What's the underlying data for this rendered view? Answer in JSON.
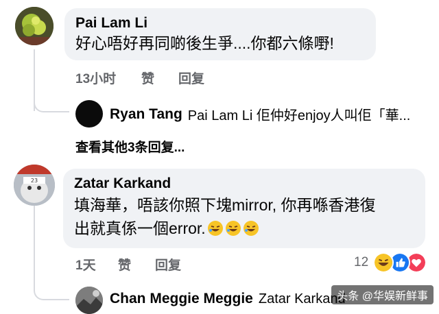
{
  "comments": [
    {
      "author": "Pai Lam Li",
      "text": "好心唔好再同啲後生爭....你都六條嘢!",
      "time": "13小时",
      "like_label": "赞",
      "reply_label": "回复",
      "reply_preview": {
        "author": "Ryan Tang",
        "text": "Pai Lam Li 佢仲好enjoy人叫佢「華..."
      },
      "view_more": "查看其他3条回复..."
    },
    {
      "author": "Zatar Karkand",
      "text_line1": "填海華，唔該你照下塊mirror, 你再喺香港復",
      "text_line2": "出就真係一個error.",
      "avatar_label": "23",
      "time": "1天",
      "like_label": "赞",
      "reply_label": "回复",
      "reaction_count": "12",
      "reaction_icons": [
        "laughing-emoji-icon",
        "like-icon",
        "love-icon"
      ],
      "reply_preview": {
        "author": "Chan Meggie Meggie",
        "text": "Zatar Karkand"
      }
    }
  ],
  "watermark": "头条 @华娱新鲜事",
  "colors": {
    "bubble": "#f0f2f5",
    "meta": "#65676b",
    "like_blue": "#1877f2",
    "love_red": "#f33e58",
    "emoji_yellow": "#f7c427"
  }
}
